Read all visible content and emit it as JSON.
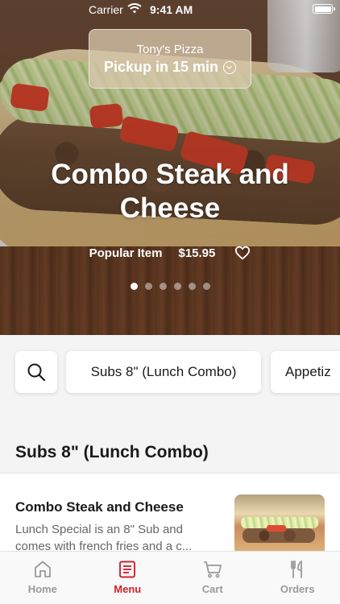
{
  "status_bar": {
    "carrier": "Carrier",
    "time": "9:41 AM"
  },
  "pickup": {
    "store_name": "Tony's Pizza",
    "pickup_text": "Pickup in 15 min"
  },
  "hero": {
    "title": "Combo Steak and Cheese",
    "badge": "Popular Item",
    "price": "$15.95",
    "carousel_count": 6,
    "carousel_active_index": 0
  },
  "categories": {
    "items": [
      "Subs 8\" (Lunch Combo)",
      "Appetizers"
    ],
    "visible_second": "Appetiz"
  },
  "section": {
    "title": "Subs 8\" (Lunch Combo)"
  },
  "menu_item": {
    "name": "Combo Steak and Cheese",
    "description": "Lunch Special is an 8\" Sub and comes with french fries and a c..."
  },
  "tabs": [
    {
      "label": "Home",
      "icon": "home-icon"
    },
    {
      "label": "Menu",
      "icon": "menu-icon"
    },
    {
      "label": "Cart",
      "icon": "cart-icon"
    },
    {
      "label": "Orders",
      "icon": "fork-knife-icon"
    }
  ],
  "active_tab": "Menu",
  "colors": {
    "accent": "#d0232b",
    "inactive": "#9a9a9a"
  }
}
